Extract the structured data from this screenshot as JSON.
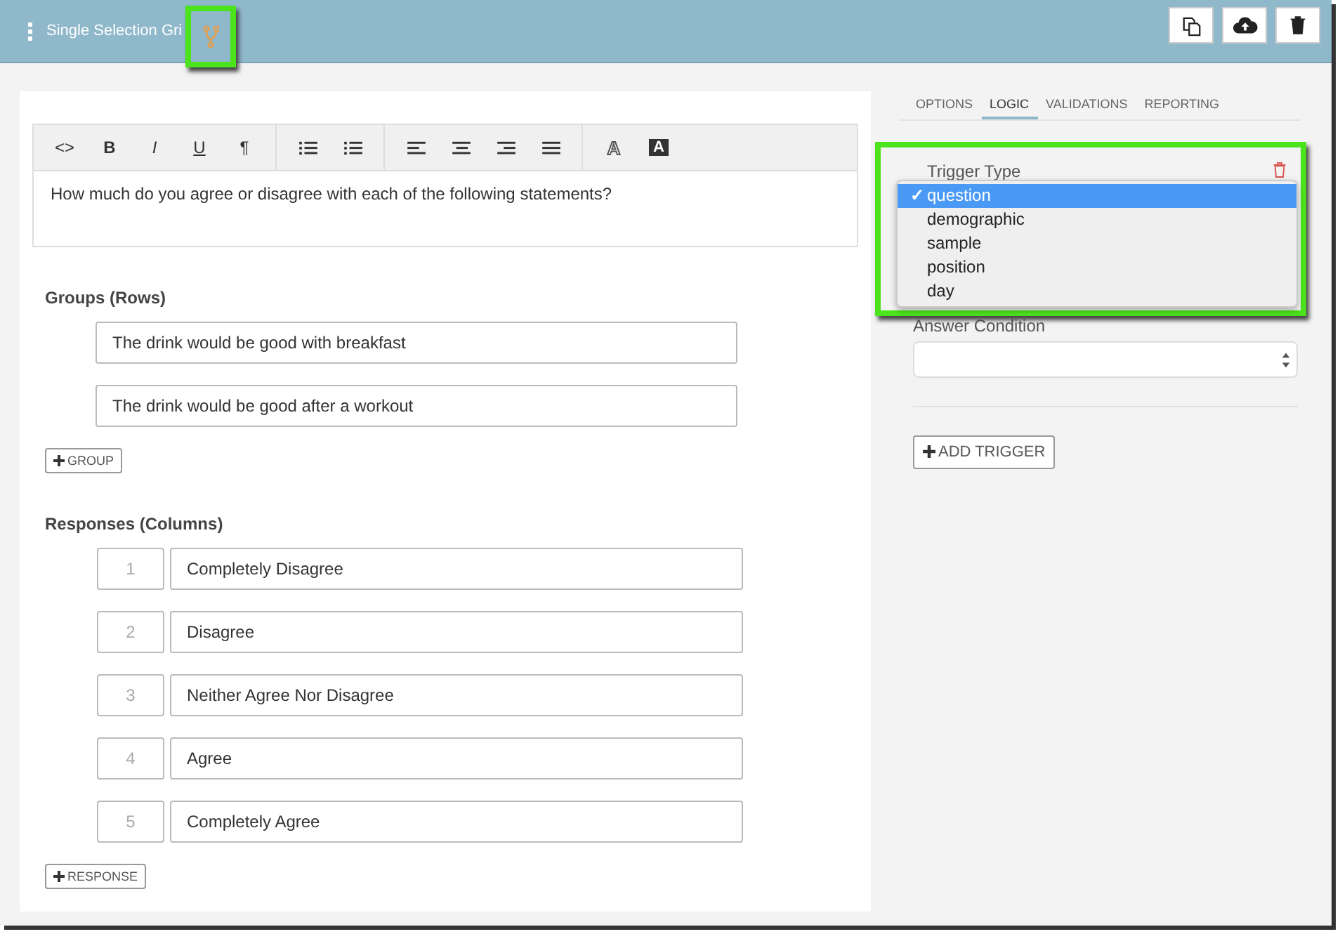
{
  "header": {
    "title": "Single Selection Gri",
    "actions": [
      {
        "kind": "copy"
      },
      {
        "kind": "upload"
      },
      {
        "kind": "delete"
      }
    ]
  },
  "toolbar": [
    [
      {
        "kind": "text",
        "label": "<>"
      },
      {
        "kind": "text",
        "label": "B"
      },
      {
        "kind": "text",
        "label": "I"
      },
      {
        "kind": "text",
        "label": "U"
      },
      {
        "kind": "text",
        "label": "¶"
      }
    ],
    [
      {
        "kind": "bullets"
      },
      {
        "kind": "numbers"
      }
    ],
    [
      {
        "kind": "align-left"
      },
      {
        "kind": "align-center"
      },
      {
        "kind": "align-right"
      },
      {
        "kind": "justify"
      }
    ],
    [
      {
        "kind": "text-color",
        "label": "A"
      },
      {
        "kind": "highlight",
        "label": "A"
      }
    ]
  ],
  "question": "How much do you agree or disagree with each of the following statements?",
  "groups": {
    "heading": "Groups (Rows)",
    "rows": [
      "The drink would be good with breakfast",
      "The drink would be good after a workout"
    ],
    "add": "GROUP"
  },
  "responses": {
    "heading": "Responses (Columns)",
    "rows": [
      {
        "number": "1",
        "label": "Completely Disagree"
      },
      {
        "number": "2",
        "label": "Disagree"
      },
      {
        "number": "3",
        "label": "Neither Agree Nor Disagree"
      },
      {
        "number": "4",
        "label": "Agree"
      },
      {
        "number": "5",
        "label": "Completely Agree"
      }
    ],
    "add": "RESPONSE"
  },
  "tabs": [
    {
      "label": "OPTIONS",
      "selected": false
    },
    {
      "label": "LOGIC",
      "selected": true
    },
    {
      "label": "VALIDATIONS",
      "selected": false
    },
    {
      "label": "REPORTING",
      "selected": false
    }
  ],
  "trigger": {
    "label": "Trigger Type",
    "options": [
      {
        "label": "question",
        "selected": true
      },
      {
        "label": "demographic",
        "selected": false
      },
      {
        "label": "sample",
        "selected": false
      },
      {
        "label": "position",
        "selected": false
      },
      {
        "label": "day",
        "selected": false
      }
    ],
    "check": "✓"
  },
  "answer_condition": {
    "label": "Answer Condition"
  },
  "add_trigger": "ADD TRIGGER"
}
